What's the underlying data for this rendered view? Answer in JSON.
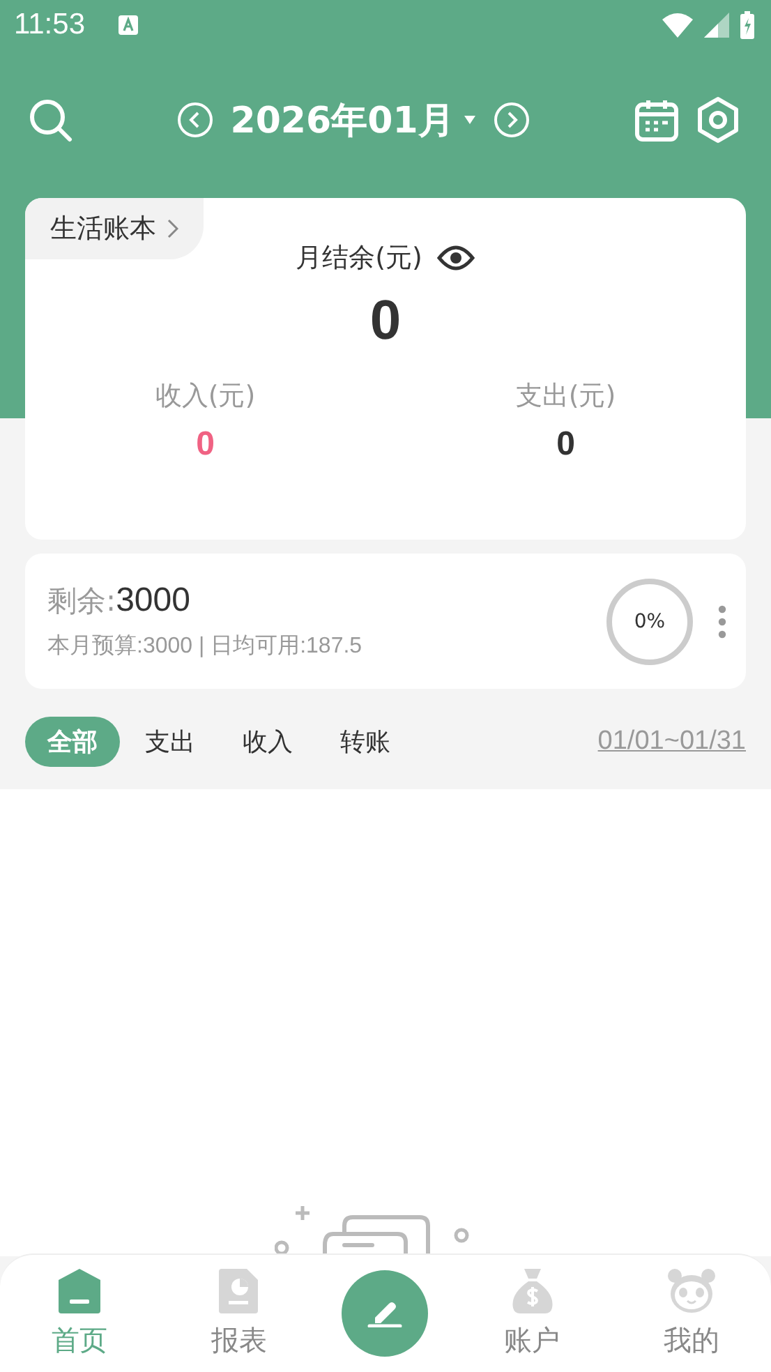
{
  "status_bar": {
    "time": "11:53"
  },
  "header": {
    "month": "2026年01月"
  },
  "summary": {
    "book": "生活账本",
    "balance_label": "月结余(元)",
    "balance": "0",
    "income_label": "收入(元)",
    "income": "0",
    "expense_label": "支出(元)",
    "expense": "0"
  },
  "budget": {
    "remaining_label": "剩余:",
    "remaining": "3000",
    "detail": "本月预算:3000 | 日均可用:187.5",
    "progress": "0%",
    "level": 0
  },
  "filters": [
    {
      "label": "全部",
      "selected": true
    },
    {
      "label": "支出",
      "selected": false
    },
    {
      "label": "收入",
      "selected": false
    },
    {
      "label": "转账",
      "selected": false
    }
  ],
  "date_range": "01/01~01/31",
  "nav": [
    {
      "label": "首页",
      "kind": "home",
      "selected": true
    },
    {
      "label": "报表",
      "kind": "report",
      "selected": false
    },
    {
      "kind": "add"
    },
    {
      "label": "账户",
      "kind": "account",
      "selected": false
    },
    {
      "label": "我的",
      "kind": "me",
      "selected": false
    }
  ]
}
